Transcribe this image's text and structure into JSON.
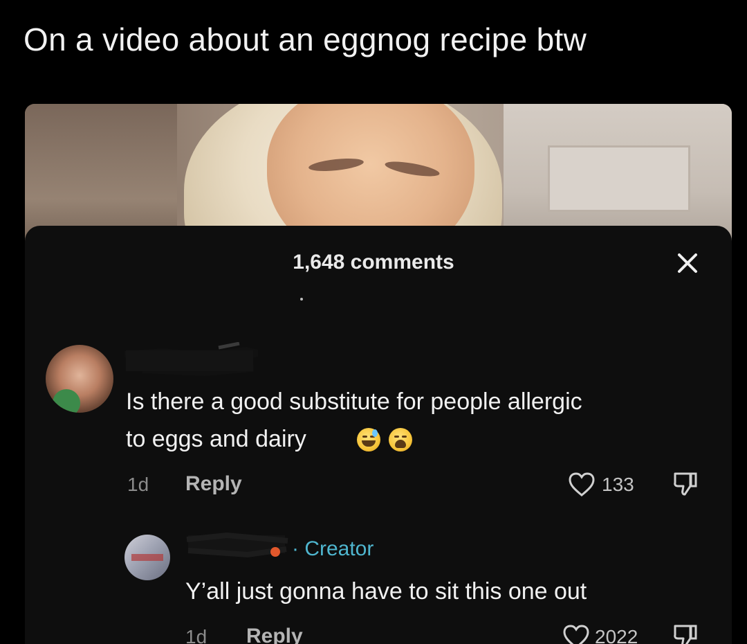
{
  "caption": "On a video about an eggnog recipe btw",
  "sheet": {
    "comment_count": "1,648 comments"
  },
  "comments": [
    {
      "text_line1": "Is there a good substitute for people allergic",
      "text_line2": "to eggs and dairy",
      "emojis": [
        "sweat-smile-emoji",
        "weary-emoji"
      ],
      "age": "1d",
      "reply_label": "Reply",
      "likes": "133"
    },
    {
      "badge": "· Creator",
      "text": "Y’all just gonna have to sit this one out",
      "age": "1d",
      "reply_label": "Reply",
      "likes": "2022"
    }
  ],
  "colors": {
    "background": "#000000",
    "sheet": "#0e0e0e",
    "creator_badge": "#4fb6cf",
    "text": "#f1f1f1",
    "muted": "#8c8c8c"
  }
}
